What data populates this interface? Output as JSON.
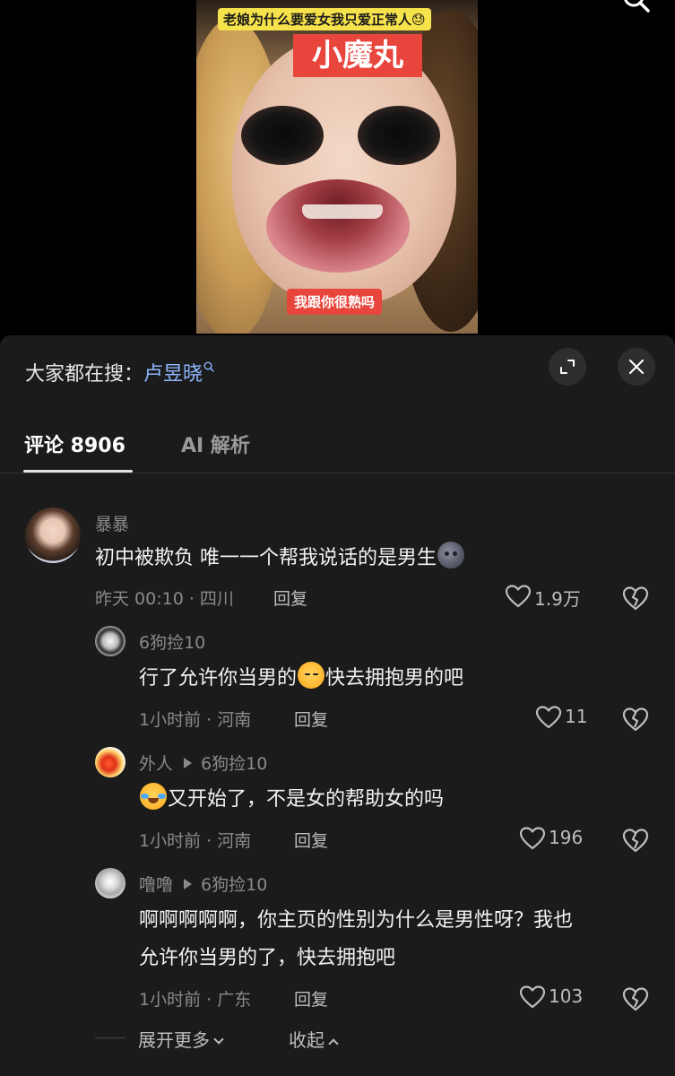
{
  "video": {
    "top_caption": "老娘为什么要爱女我只爱正常人😓",
    "red_label": "小魔丸",
    "bottom_caption": "我跟你很熟吗"
  },
  "search_bar": {
    "prefix": "大家都在搜：",
    "term": "卢昱晓"
  },
  "tabs": {
    "comments": "评论 8906",
    "ai": "AI 解析"
  },
  "comments": [
    {
      "name": "暴暴",
      "text": "初中被欺负 唯一一个帮我说话的是男生",
      "meta": "昨天 00:10 · 四川",
      "reply_label": "回复",
      "likes": "1.9万"
    }
  ],
  "replies": [
    {
      "name": "6狗捡10",
      "reply_to": "",
      "text_before": "行了允许你当男的",
      "text_after": "快去拥抱男的吧",
      "meta": "1小时前 · 河南",
      "reply_label": "回复",
      "likes": "11"
    },
    {
      "name": "外人",
      "reply_to": "6狗捡10",
      "text_before": "",
      "text_after": "又开始了，不是女的帮助女的吗",
      "meta": "1小时前 · 河南",
      "reply_label": "回复",
      "likes": "196"
    },
    {
      "name": "噜噜",
      "reply_to": "6狗捡10",
      "text_line1": "啊啊啊啊啊，你主页的性别为什么是男性呀？我也",
      "text_line2": "允许你当男的了，快去拥抱吧",
      "meta": "1小时前 · 广东",
      "reply_label": "回复",
      "likes": "103"
    }
  ],
  "footer": {
    "expand_more": "展开更多",
    "collapse": "收起"
  },
  "colors": {
    "sheet_bg": "#1b1b1b",
    "link": "#8fb6ff",
    "caption_yellow": "#f6e24a",
    "caption_red": "#e8453c"
  }
}
